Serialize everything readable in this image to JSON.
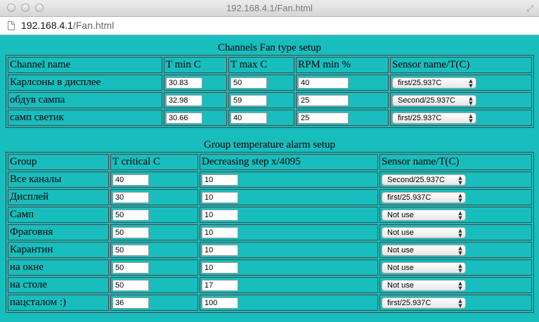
{
  "window": {
    "title": "192.168.4.1/Fan.html"
  },
  "address": {
    "host": "192.168.4.1",
    "path": "/Fan.html"
  },
  "fan_setup": {
    "title": "Channels Fan type setup",
    "headers": [
      "Channel name",
      "T min C",
      "T max C",
      "RPM min %",
      "Sensor name/T(C)"
    ],
    "rows": [
      {
        "name": "Карлсоны в дисплее",
        "tmin": "30.83",
        "tmax": "50",
        "rpm": "40",
        "sensor": "first/25.937C"
      },
      {
        "name": "обдув сампа",
        "tmin": "32.98",
        "tmax": "59",
        "rpm": "25",
        "sensor": "Second/25.937C"
      },
      {
        "name": "самп светик",
        "tmin": "30.66",
        "tmax": "40",
        "rpm": "25",
        "sensor": "first/25.937C"
      }
    ]
  },
  "alarm_setup": {
    "title": "Group temperature alarm setup",
    "headers": [
      "Group",
      "T critical C",
      "Decreasing step x/4095",
      "Sensor name/T(C)"
    ],
    "rows": [
      {
        "group": "Все каналы",
        "tcrit": "40",
        "step": "10",
        "sensor": "Second/25.937C"
      },
      {
        "group": "Дисплей",
        "tcrit": "30",
        "step": "10",
        "sensor": "first/25.937C"
      },
      {
        "group": "Самп",
        "tcrit": "50",
        "step": "10",
        "sensor": "Not use"
      },
      {
        "group": "Фраговня",
        "tcrit": "50",
        "step": "10",
        "sensor": "Not use"
      },
      {
        "group": "Карантин",
        "tcrit": "50",
        "step": "10",
        "sensor": "Not use"
      },
      {
        "group": "на окне",
        "tcrit": "50",
        "step": "10",
        "sensor": "Not use"
      },
      {
        "group": "на столе",
        "tcrit": "50",
        "step": "17",
        "sensor": "Not use"
      },
      {
        "group": "пацсталом :)",
        "tcrit": "36",
        "step": "100",
        "sensor": "first/25.937C"
      }
    ]
  },
  "icons": {
    "select_arrow": "▲▼",
    "resize": "⤢"
  },
  "colors": {
    "page_background": "#18bdbd",
    "border": "#4a4a4a"
  }
}
